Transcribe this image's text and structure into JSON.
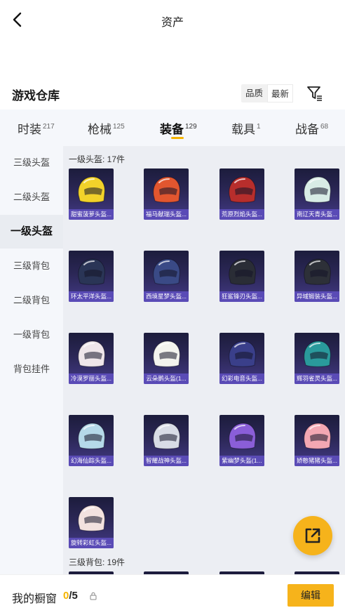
{
  "header": {
    "title": "资产"
  },
  "section": {
    "title": "游戏仓库",
    "sort_options": [
      "品质",
      "最新"
    ],
    "active_sort": "最新"
  },
  "tabs": [
    {
      "label": "时装",
      "count": "217"
    },
    {
      "label": "枪械",
      "count": "125"
    },
    {
      "label": "装备",
      "count": "129"
    },
    {
      "label": "载具",
      "count": "1"
    },
    {
      "label": "战备",
      "count": "68"
    }
  ],
  "sidebar": {
    "items": [
      {
        "label": "三级头盔"
      },
      {
        "label": "二级头盔"
      },
      {
        "label": "一级头盔"
      },
      {
        "label": "三级背包"
      },
      {
        "label": "二级背包"
      },
      {
        "label": "一级背包"
      },
      {
        "label": "背包挂件"
      }
    ]
  },
  "groups": [
    {
      "title": "一级头盔: 17件",
      "items": [
        {
          "name": "甜蜜菠萝头盔...",
          "color": "#f2d22a"
        },
        {
          "name": "福马献瑞头盔...",
          "color": "#e2562f"
        },
        {
          "name": "荒原烈焰头盔...",
          "color": "#b72e2c"
        },
        {
          "name": "南辽天青头盔...",
          "color": "#d8ece6"
        },
        {
          "name": "环太平洋头盔...",
          "color": "#2a3556"
        },
        {
          "name": "西境星梦头盔...",
          "color": "#3a4a86"
        },
        {
          "name": "狂鲨锋刃头盔...",
          "color": "#2a2d36"
        },
        {
          "name": "异域锻装头盔...",
          "color": "#2d3038"
        },
        {
          "name": "冷漠罗丽头盔...",
          "color": "#efe6ea"
        },
        {
          "name": "云朵鹅头盔(1...",
          "color": "#f3f3ee"
        },
        {
          "name": "幻彩电音头盔...",
          "color": "#3a3f8a"
        },
        {
          "name": "辉羽雀灵头盔...",
          "color": "#2a9a9c"
        },
        {
          "name": "幻海仙踪头盔...",
          "color": "#b5d9e9"
        },
        {
          "name": "智耀战神头盔...",
          "color": "#d8dce6"
        },
        {
          "name": "紫幽梦头盔(1...",
          "color": "#8a5ed8"
        },
        {
          "name": "娇憨猪猪头盔...",
          "color": "#f3a7b3"
        },
        {
          "name": "旋转彩虹头盔...",
          "color": "#f3e2df"
        }
      ]
    },
    {
      "title": "三级背包: 19件"
    }
  ],
  "cabinet": {
    "label": "我的橱窗",
    "current": "0",
    "total": "/5",
    "edit_label": "编辑"
  },
  "colors": {
    "accent": "#f6b31b",
    "card_name_bg": "#5a4bb6"
  }
}
